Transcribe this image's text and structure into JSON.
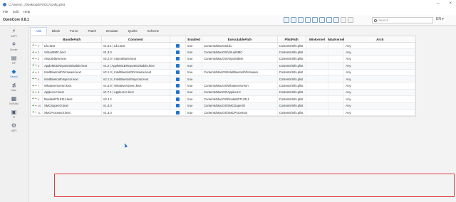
{
  "window": {
    "path": "C:/Users/.../Desktop/EFI/OC/config.plist",
    "minimize": "–",
    "close": "×"
  },
  "menu": [
    "File",
    "Edit",
    "Help"
  ],
  "toolbar": {
    "app_name": "OpenCore 0.8.1",
    "search_placeholder": "Search",
    "lang": "EN ▾"
  },
  "sidebar": {
    "items": [
      {
        "label": "ACPI",
        "icon": "acpi-icon"
      },
      {
        "label": "Booter",
        "icon": "booter-icon"
      },
      {
        "label": "DP",
        "icon": "deviceproperties-icon"
      },
      {
        "label": "Kernel",
        "icon": "kernel-icon",
        "active": true
      },
      {
        "label": "Misc",
        "icon": "misc-icon"
      },
      {
        "label": "NVRAM",
        "icon": "nvram-icon"
      },
      {
        "label": "PI",
        "icon": "platforminfo-icon"
      },
      {
        "label": "UEFI",
        "icon": "uefi-icon"
      }
    ]
  },
  "tabs": [
    "Add",
    "Block",
    "Force",
    "Patch",
    "Emulate",
    "Quirks",
    "Scheme"
  ],
  "table": {
    "headers": [
      "",
      "BundlePath",
      "Comment",
      "Enabled",
      "ExecutablePath",
      "PlistPath",
      "MinKernel",
      "MaxKernel",
      "Arch"
    ],
    "rows": [
      {
        "num": "1",
        "bundle": "Lilu.kext",
        "comment": "V1.6.1 | Lilu.kext",
        "enabled": "true",
        "exec": "Contents/MacOS/Lilu",
        "plist": "Contents/Info.plist",
        "arch": "Any"
      },
      {
        "num": "2",
        "bundle": "VirtualSMC.kext",
        "comment": "V1.3.0",
        "enabled": "true",
        "exec": "Contents/MacOS/VirtualSMC",
        "plist": "Contents/Info.plist",
        "arch": "Any"
      },
      {
        "num": "3",
        "bundle": "AirportItlwm.kext",
        "comment": "V2.2.0 | AirportItlwm.kext",
        "enabled": "true",
        "exec": "Contents/MacOS/AirportItlwm",
        "plist": "Contents/Info.plist",
        "arch": "Any"
      },
      {
        "num": "4",
        "bundle": "AppleMCEReporterDisabler.kext",
        "comment": "V1.2 | AppleMCEReporterDisabler.kext",
        "enabled": "true",
        "exec": "",
        "plist": "Contents/Info.plist",
        "arch": "Any"
      },
      {
        "num": "5",
        "bundle": "IntelBluetoothFirmware.kext",
        "comment": "V2.1.0 | IntelBluetoothFirmware.kext",
        "enabled": "true",
        "exec": "Contents/MacOS/IntelBluetoothFirmware",
        "plist": "Contents/Info.plist",
        "arch": "Any"
      },
      {
        "num": "6",
        "bundle": "IntelBluetoothInjector.kext",
        "comment": "V2.1.0 | IntelBluetoothInjector.kext",
        "enabled": "true",
        "exec": "",
        "plist": "Contents/Info.plist",
        "arch": "Any"
      },
      {
        "num": "7",
        "bundle": "WhateverGreen.kext",
        "comment": "V1.5.9 | WhateverGreen.kext",
        "enabled": "true",
        "exec": "Contents/MacOS/WhateverGreen",
        "plist": "Contents/Info.plist",
        "arch": "Any"
      },
      {
        "num": "8",
        "bundle": "AppleALC.kext",
        "comment": "V1.7.1 | AppleALC.kext",
        "enabled": "true",
        "exec": "Contents/MacOS/AppleALC",
        "plist": "Contents/Info.plist",
        "arch": "Any"
      },
      {
        "num": "9",
        "bundle": "RealtekRTL8111.kext",
        "comment": "V2.4.2",
        "enabled": "true",
        "exec": "Contents/MacOS/RealtekRTL8111",
        "plist": "Contents/Info.plist",
        "arch": "Any"
      },
      {
        "num": "10",
        "bundle": "SMCSuperIO.kext",
        "comment": "V1.3.0",
        "enabled": "true",
        "exec": "Contents/MacOS/SMCSuperIO",
        "plist": "Contents/Info.plist",
        "arch": "Any"
      },
      {
        "num": "11",
        "bundle": "SMCProcessor.kext",
        "comment": "V1.3.0",
        "enabled": "true",
        "exec": "Contents/MacOS/SMCProcessor",
        "plist": "Contents/Info.plist",
        "arch": "Any"
      }
    ]
  },
  "colors": {
    "accent": "#1e73d2",
    "highlight": "#e23b3b",
    "add": "#2a9a3a",
    "remove": "#cc2233"
  }
}
